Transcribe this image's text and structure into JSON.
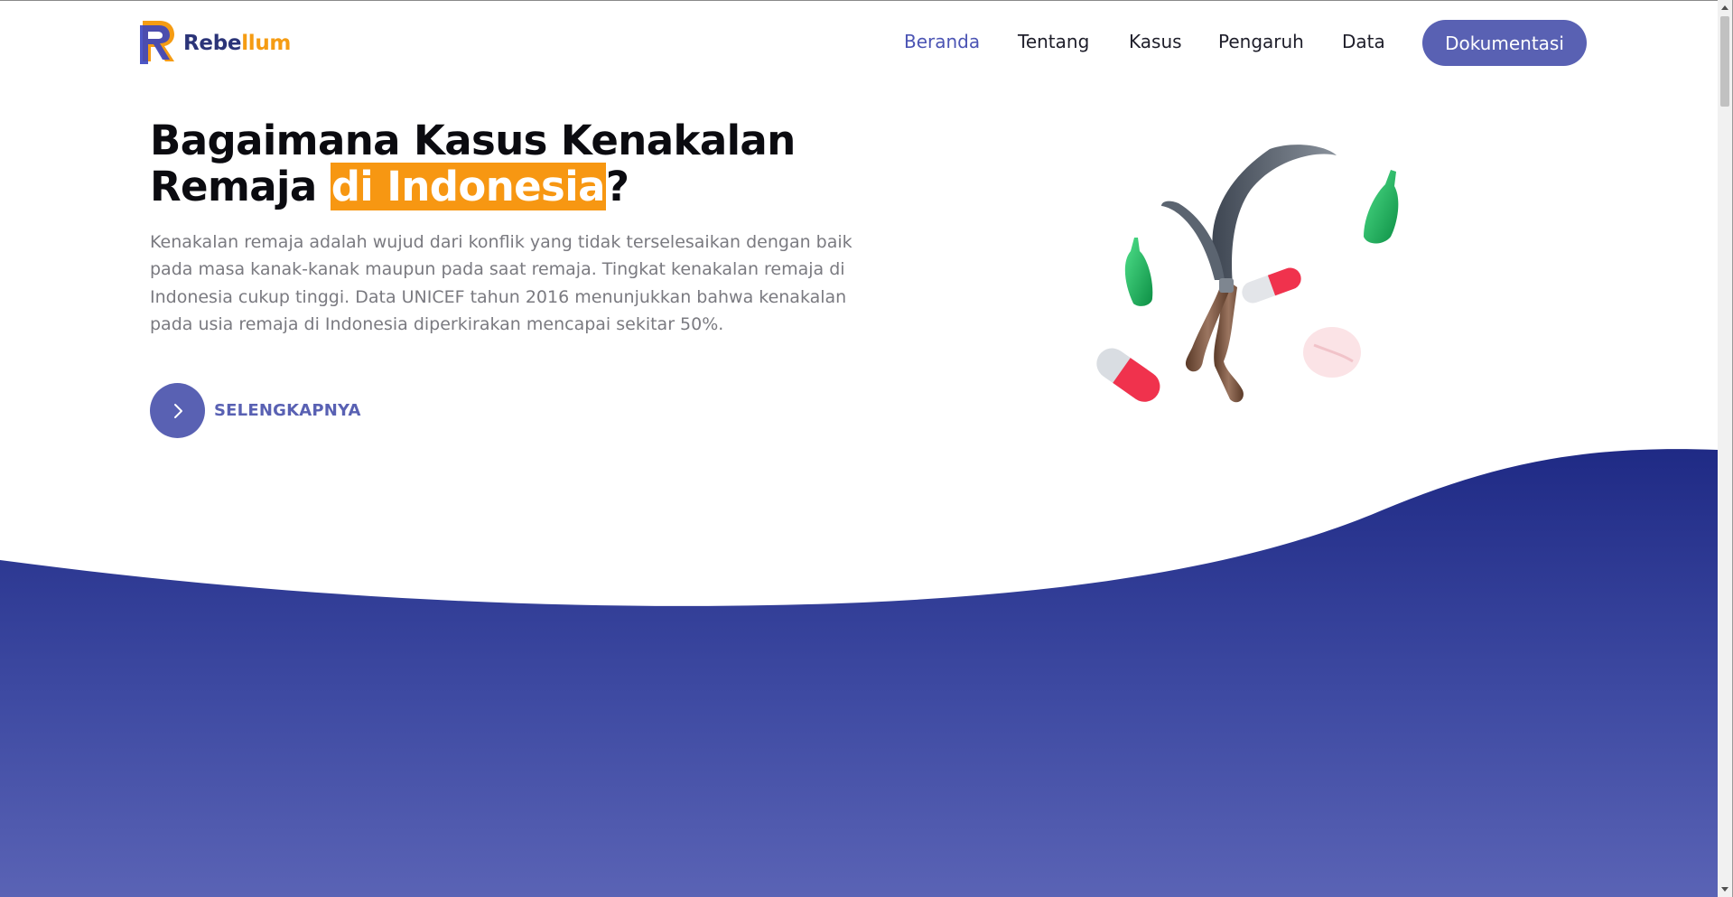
{
  "header": {
    "logo_part1": "Rebe",
    "logo_part2": "llum",
    "nav": [
      {
        "label": "Beranda",
        "active": true
      },
      {
        "label": "Tentang",
        "active": false
      },
      {
        "label": "Kasus",
        "active": false
      },
      {
        "label": "Pengaruh",
        "active": false
      },
      {
        "label": "Data",
        "active": false
      }
    ],
    "cta_label": "Dokumentasi"
  },
  "hero": {
    "title_line1": "Bagaimana Kasus Kenakalan",
    "title_line2_pre": "Remaja ",
    "title_highlight": "di Indonesia",
    "title_suffix": "?",
    "description": "Kenakalan remaja adalah wujud dari konflik yang tidak terselesaikan dengan baik pada masa kanak-kanak maupun pada saat remaja. Tingkat kenakalan remaja di Indonesia cukup tinggi. Data UNICEF tahun 2016 menunjukkan bahwa kenakalan pada usia remaja di Indonesia diperkirakan mencapai sekitar 50%.",
    "more_label": "SELENGKAPNYA",
    "more_icon": "chevron-right-icon"
  },
  "theme": {
    "brand_blue": "#5961b3",
    "brand_navy": "#1f2a85",
    "brand_orange": "#f79712",
    "active_nav": "#4b54b4"
  }
}
